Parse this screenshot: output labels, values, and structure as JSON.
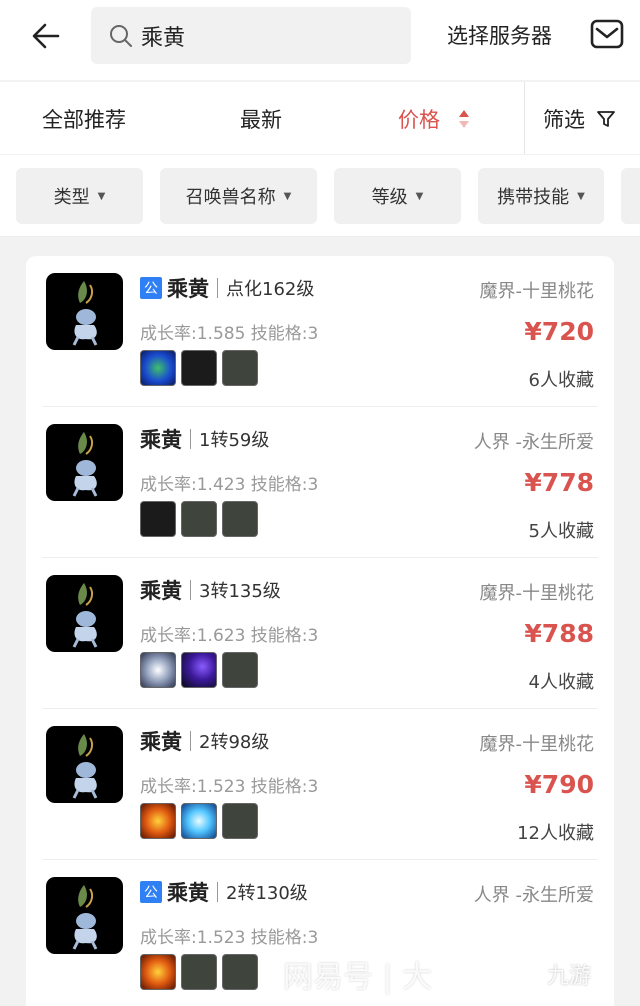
{
  "header": {
    "search_text": "乘黄",
    "server_label": "选择服务器"
  },
  "sortbar": {
    "recommend": "全部推荐",
    "newest": "最新",
    "price": "价格",
    "filter": "筛选"
  },
  "chips": [
    {
      "label": "类型"
    },
    {
      "label": "召唤兽名称"
    },
    {
      "label": "等级"
    },
    {
      "label": "携带技能"
    }
  ],
  "items": [
    {
      "badge": "公",
      "name": "乘黄",
      "level": "点化162级",
      "stats": "成长率:1.585 技能格:3",
      "server": "魔界-十里桃花",
      "price": "¥720",
      "favs": "6人收藏",
      "skills": [
        "blue-face",
        "dark",
        "grey"
      ]
    },
    {
      "badge": "",
      "name": "乘黄",
      "level": "1转59级",
      "stats": "成长率:1.423 技能格:3",
      "server": "人界 -永生所爱",
      "price": "¥778",
      "favs": "5人收藏",
      "skills": [
        "dark",
        "grey",
        "grey"
      ]
    },
    {
      "badge": "",
      "name": "乘黄",
      "level": "3转135级",
      "stats": "成长率:1.623 技能格:3",
      "server": "魔界-十里桃花",
      "price": "¥788",
      "favs": "4人收藏",
      "skills": [
        "yin-yang",
        "purple-crescent",
        "grey"
      ]
    },
    {
      "badge": "",
      "name": "乘黄",
      "level": "2转98级",
      "stats": "成长率:1.523 技能格:3",
      "server": "魔界-十里桃花",
      "price": "¥790",
      "favs": "12人收藏",
      "skills": [
        "fire-face",
        "ice-figure",
        "grey"
      ]
    },
    {
      "badge": "公",
      "name": "乘黄",
      "level": "2转130级",
      "stats": "成长率:1.523 技能格:3",
      "server": "人界 -永生所爱",
      "price": "",
      "favs": "",
      "skills": [
        "fire-face",
        "grey",
        "grey"
      ]
    }
  ],
  "watermark": {
    "text": "网易号 | 大",
    "logo": "九游"
  }
}
